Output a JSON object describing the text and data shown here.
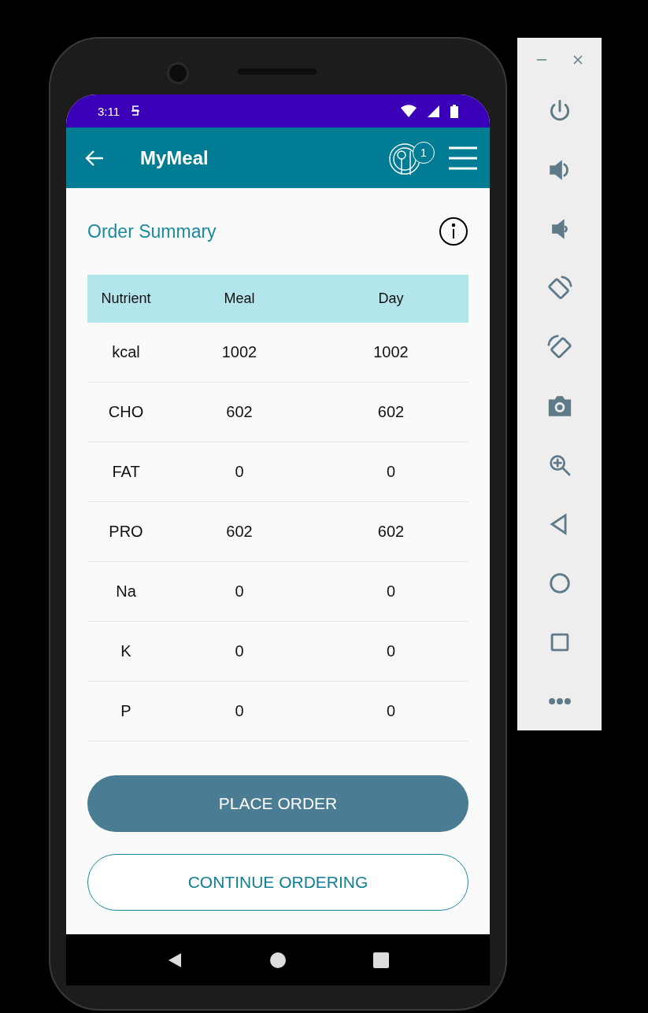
{
  "status_bar": {
    "time": "3:11"
  },
  "app_bar": {
    "title": "MyMeal",
    "cart_count": "1"
  },
  "order_summary": {
    "title": "Order Summary",
    "table": {
      "columns": [
        "Nutrient",
        "Meal",
        "Day"
      ],
      "rows": [
        [
          "kcal",
          "1002",
          "1002"
        ],
        [
          "CHO",
          "602",
          "602"
        ],
        [
          "FAT",
          "0",
          "0"
        ],
        [
          "PRO",
          "602",
          "602"
        ],
        [
          "Na",
          "0",
          "0"
        ],
        [
          "K",
          "0",
          "0"
        ],
        [
          "P",
          "0",
          "0"
        ]
      ]
    }
  },
  "buttons": [
    {
      "label": "PLACE ORDER",
      "kind": "primary"
    },
    {
      "label": "CONTINUE ORDERING",
      "kind": "outlined"
    }
  ]
}
